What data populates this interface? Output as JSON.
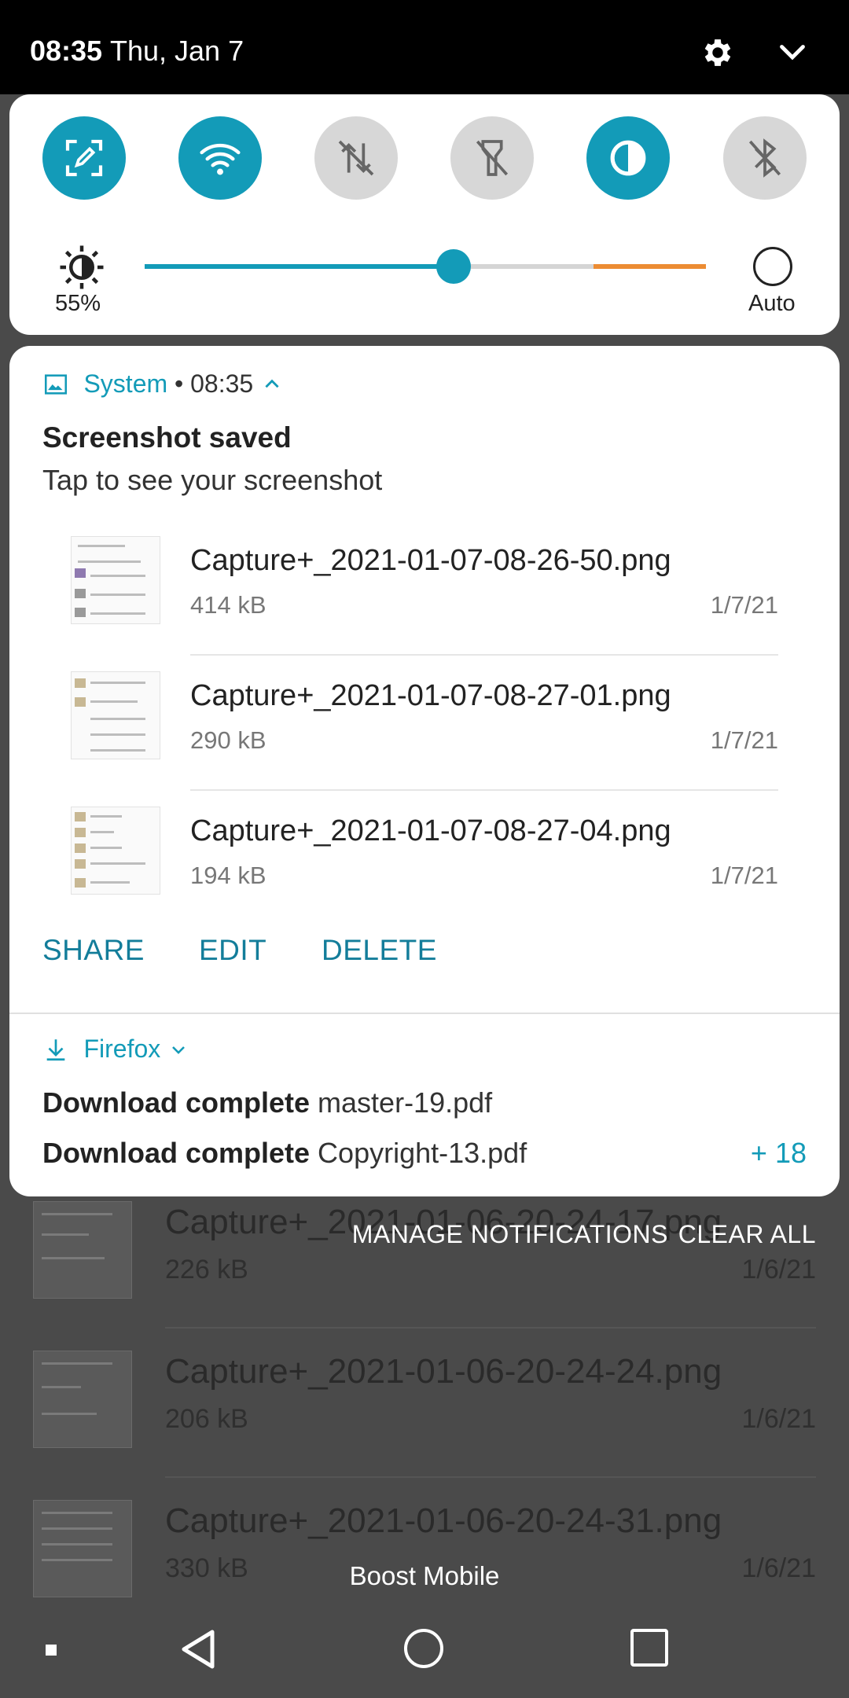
{
  "status_bar": {
    "time": "08:35",
    "date": "Thu, Jan 7"
  },
  "quick_settings": {
    "tiles": [
      {
        "name": "screen-capture",
        "state": "on"
      },
      {
        "name": "wifi",
        "state": "on"
      },
      {
        "name": "mobile-data",
        "state": "off"
      },
      {
        "name": "flashlight",
        "state": "off"
      },
      {
        "name": "color-inversion",
        "state": "on"
      },
      {
        "name": "bluetooth",
        "state": "off"
      }
    ],
    "brightness_label": "55%",
    "brightness_level": 0.55,
    "auto_label": "Auto",
    "accent_color": "#139bb8",
    "warning_color": "#ec8c33"
  },
  "screenshot_notification": {
    "app_name": "System",
    "meta": " • 08:35",
    "title": "Screenshot saved",
    "text": "Tap to see your screenshot",
    "items": [
      {
        "name": "Capture+_2021-01-07-08-26-50.png",
        "size": "414 kB",
        "date": "1/7/21"
      },
      {
        "name": "Capture+_2021-01-07-08-27-01.png",
        "size": "290 kB",
        "date": "1/7/21"
      },
      {
        "name": "Capture+_2021-01-07-08-27-04.png",
        "size": "194 kB",
        "date": "1/7/21"
      }
    ],
    "actions": {
      "share": "SHARE",
      "edit": "EDIT",
      "delete": "DELETE"
    }
  },
  "firefox_notification": {
    "app_name": "Firefox",
    "downloads": [
      {
        "status": "Download complete",
        "file": "master-19.pdf"
      },
      {
        "status": "Download complete",
        "file": "Copyright-13.pdf"
      }
    ],
    "more_count": "+ 18"
  },
  "shade_actions": {
    "manage": "MANAGE NOTIFICATIONS",
    "clear_all": "CLEAR ALL"
  },
  "background_list": [
    {
      "name": "Capture+_2021-01-06-20-24-17.png",
      "size": "226 kB",
      "date": "1/6/21"
    },
    {
      "name": "Capture+_2021-01-06-20-24-24.png",
      "size": "206 kB",
      "date": "1/6/21"
    },
    {
      "name": "Capture+_2021-01-06-20-24-31.png",
      "size": "330 kB",
      "date": "1/6/21"
    }
  ],
  "carrier": "Boost Mobile"
}
